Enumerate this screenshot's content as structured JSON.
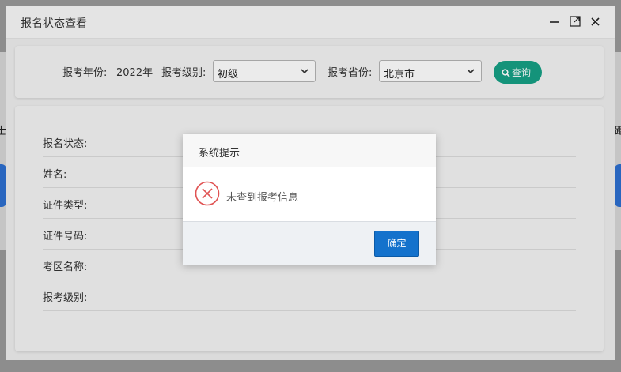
{
  "window": {
    "title": "报名状态查看",
    "controls": [
      "minimize-icon",
      "maximize-icon",
      "close-icon"
    ]
  },
  "filters": {
    "year_label": "报考年份:",
    "year_value": "2022年",
    "level_label": "报考级别:",
    "level_value": "初级",
    "province_label": "报考省份:",
    "province_value": "北京市",
    "query_label": "查询"
  },
  "info": {
    "fields": [
      {
        "label": "报名状态:"
      },
      {
        "label": "姓名:"
      },
      {
        "label": "证件类型:"
      },
      {
        "label": "证件号码:"
      },
      {
        "label": "考区名称:"
      },
      {
        "label": "报考级别:"
      }
    ]
  },
  "modal": {
    "title": "系统提示",
    "message": "未查到报考信息",
    "ok_label": "确定",
    "icon": "error-circle-icon"
  },
  "background": {
    "left_text": "士",
    "right_text": "距"
  },
  "colors": {
    "accent_green": "#16a085",
    "ok_blue": "#1472cc",
    "error_red": "#e05353"
  }
}
